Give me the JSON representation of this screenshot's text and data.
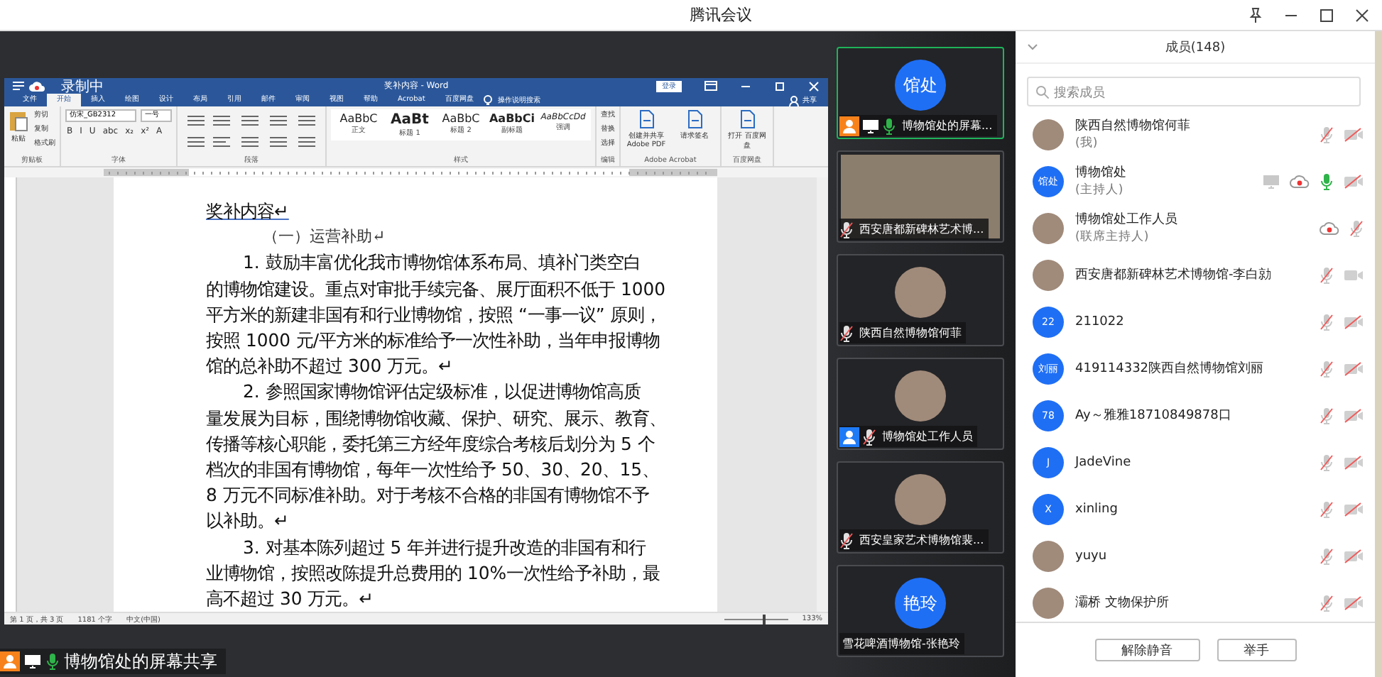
{
  "window": {
    "title": "腾讯会议"
  },
  "recording": {
    "label": "录制中"
  },
  "word": {
    "title": "奖补内容 - Word",
    "login": "登录",
    "share": "共享",
    "tabs": [
      {
        "label": "文件",
        "selected": false
      },
      {
        "label": "开始",
        "selected": true
      },
      {
        "label": "插入",
        "selected": false
      },
      {
        "label": "绘图",
        "selected": false
      },
      {
        "label": "设计",
        "selected": false
      },
      {
        "label": "布局",
        "selected": false
      },
      {
        "label": "引用",
        "selected": false
      },
      {
        "label": "邮件",
        "selected": false
      },
      {
        "label": "审阅",
        "selected": false
      },
      {
        "label": "视图",
        "selected": false
      },
      {
        "label": "帮助",
        "selected": false
      },
      {
        "label": "Acrobat",
        "selected": false
      },
      {
        "label": "百度网盘",
        "selected": false
      }
    ],
    "tell_me": "操作说明搜索",
    "groups": [
      {
        "kind": "clipboard",
        "label": "剪贴板",
        "big": "粘贴",
        "buttons": [
          "剪切",
          "复制",
          "格式刷"
        ]
      },
      {
        "kind": "font",
        "label": "字体",
        "font_name": "仿宋_GB2312",
        "font_size": "一号",
        "buttons": [
          "B",
          "I",
          "U",
          "abc",
          "x₂",
          "x²",
          "A"
        ]
      },
      {
        "kind": "paragraph",
        "label": "段落"
      },
      {
        "kind": "styles",
        "label": "样式",
        "styles": [
          {
            "sample": "AaBbC",
            "name": "正文"
          },
          {
            "sample": "AaBt",
            "name": "标题 1"
          },
          {
            "sample": "AaBbC",
            "name": "标题 2"
          },
          {
            "sample": "AaBbCi",
            "name": "副标题"
          },
          {
            "sample": "AaBbCcDd",
            "name": "强调"
          }
        ]
      },
      {
        "kind": "editing",
        "label": "编辑",
        "buttons": [
          "查找",
          "替换",
          "选择"
        ]
      },
      {
        "kind": "tools",
        "label": "Adobe Acrobat",
        "buttons": [
          "创建并共享 Adobe PDF",
          "请求签名"
        ]
      },
      {
        "kind": "tools",
        "label": "百度网盘",
        "buttons": [
          "打开 百度网盘"
        ]
      }
    ],
    "document": [
      {
        "kind": "heading",
        "lines": [
          "奖补内容↵"
        ]
      },
      {
        "kind": "subheading",
        "lines": [
          "（一）运营补助↵"
        ]
      },
      {
        "kind": "para",
        "lines": [
          "1. 鼓励丰富优化我市博物馆体系布局、填补门类空白",
          "的博物馆建设。重点对审批手续完备、展厅面积不低于 1000",
          "平方米的新建非国有和行业博物馆，按照 “一事一议” 原则，",
          "按照 1000 元/平方米的标准给予一次性补助，当年申报博物",
          "馆的总补助不超过 300 万元。↵"
        ]
      },
      {
        "kind": "para",
        "lines": [
          "2. 参照国家博物馆评估定级标准，以促进博物馆高质",
          "量发展为目标，围绕博物馆收藏、保护、研究、展示、教育、",
          "传播等核心职能，委托第三方经年度综合考核后划分为 5 个",
          "档次的非国有博物馆，每年一次性给予 50、30、20、15、",
          "8 万元不同标准补助。对于考核不合格的非国有博物馆不予",
          "以补助。↵"
        ]
      },
      {
        "kind": "para",
        "lines": [
          "3. 对基本陈列超过  5  年并进行提升改造的非国有和行",
          "业博物馆，按照改陈提升总费用的 10%一次性给予补助，最",
          "高不超过 30 万元。↵"
        ]
      }
    ],
    "status_bar": {
      "page": "第 1 页，共 3 页",
      "words": "1181 个字",
      "language": "中文(中国)",
      "zoom": "133%",
      "level": 0.6
    }
  },
  "share_label": {
    "text": "博物馆处的屏幕共享"
  },
  "tiles": [
    {
      "name": "博物馆处的屏幕...",
      "selected": true,
      "avatar": {
        "kind": "initials",
        "text": "馆处"
      },
      "icons": [
        {
          "kind": "host"
        },
        {
          "kind": "screen"
        },
        {
          "kind": "mic",
          "muted": false
        }
      ]
    },
    {
      "name": "西安唐都新碑林艺术博...",
      "selected": false,
      "avatar": {
        "kind": "video"
      },
      "icons": [
        {
          "kind": "mic",
          "muted": true
        }
      ]
    },
    {
      "name": "陕西自然博物馆何菲",
      "selected": false,
      "avatar": {
        "kind": "photo"
      },
      "icons": [
        {
          "kind": "mic",
          "muted": true
        }
      ]
    },
    {
      "name": "博物馆处工作人员",
      "selected": false,
      "avatar": {
        "kind": "photo"
      },
      "icons": [
        {
          "kind": "cohost"
        },
        {
          "kind": "mic",
          "muted": true
        }
      ]
    },
    {
      "name": "西安皇家艺术博物馆裴...",
      "selected": false,
      "avatar": {
        "kind": "photo"
      },
      "icons": [
        {
          "kind": "mic",
          "muted": true
        }
      ]
    },
    {
      "name": "雪花啤酒博物馆-张艳玲",
      "selected": false,
      "avatar": {
        "kind": "initials",
        "text": "艳玲"
      }
    }
  ],
  "members": {
    "title": "成员(148)",
    "search": {
      "placeholder": "搜索成员"
    },
    "items": [
      {
        "name": "陕西自然博物馆何菲",
        "role": "(我)",
        "avatar": {
          "kind": "photo"
        },
        "icons": [
          {
            "kind": "mic",
            "muted": true
          },
          {
            "kind": "camera",
            "muted": true
          }
        ]
      },
      {
        "name": "博物馆处",
        "role": "(主持人)",
        "avatar": {
          "kind": "initials",
          "text": "馆处"
        },
        "icons": [
          {
            "kind": "screen"
          },
          {
            "kind": "record"
          },
          {
            "kind": "mic",
            "muted": false
          },
          {
            "kind": "camera",
            "muted": true
          }
        ]
      },
      {
        "name": "博物馆处工作人员",
        "role": "(联席主持人)",
        "avatar": {
          "kind": "photo"
        },
        "icons": [
          {
            "kind": "record"
          },
          {
            "kind": "mic",
            "muted": true
          }
        ]
      },
      {
        "name": "西安唐都新碑林艺术博物馆-李白勍",
        "avatar": {
          "kind": "photo"
        },
        "icons": [
          {
            "kind": "mic",
            "muted": true
          },
          {
            "kind": "camera",
            "muted": false
          }
        ]
      },
      {
        "name": "211022",
        "avatar": {
          "kind": "initials",
          "text": "22"
        },
        "icons": [
          {
            "kind": "mic",
            "muted": true
          },
          {
            "kind": "camera",
            "muted": true
          }
        ]
      },
      {
        "name": "419114332陕西自然博物馆刘丽",
        "avatar": {
          "kind": "initials",
          "text": "刘丽"
        },
        "icons": [
          {
            "kind": "mic",
            "muted": true
          },
          {
            "kind": "camera",
            "muted": true
          }
        ]
      },
      {
        "name": "Ay～雅雅18710849878口",
        "avatar": {
          "kind": "initials",
          "text": "78"
        },
        "icons": [
          {
            "kind": "mic",
            "muted": true
          },
          {
            "kind": "camera",
            "muted": true
          }
        ]
      },
      {
        "name": "JadeVine",
        "avatar": {
          "kind": "initials",
          "text": "J"
        },
        "icons": [
          {
            "kind": "mic",
            "muted": true
          },
          {
            "kind": "camera",
            "muted": true
          }
        ]
      },
      {
        "name": "xinling",
        "avatar": {
          "kind": "initials",
          "text": "X"
        },
        "icons": [
          {
            "kind": "mic",
            "muted": true
          },
          {
            "kind": "camera",
            "muted": true
          }
        ]
      },
      {
        "name": "yuyu",
        "avatar": {
          "kind": "photo"
        },
        "icons": [
          {
            "kind": "mic",
            "muted": true
          },
          {
            "kind": "camera",
            "muted": true
          }
        ]
      },
      {
        "name": "灞桥 文物保护所",
        "avatar": {
          "kind": "photo"
        },
        "icons": [
          {
            "kind": "mic",
            "muted": true
          },
          {
            "kind": "camera",
            "muted": true
          }
        ]
      }
    ],
    "buttons": [
      "解除静音",
      "举手"
    ]
  }
}
